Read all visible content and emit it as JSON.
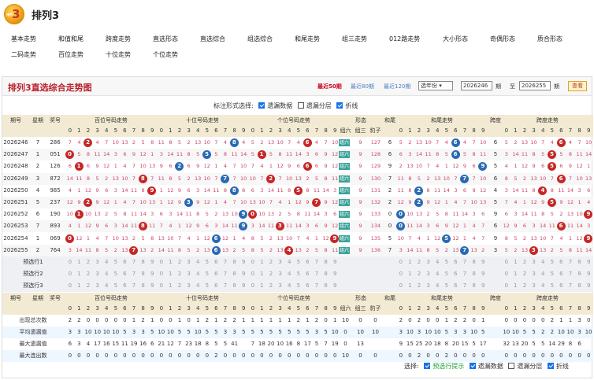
{
  "app": {
    "title": "排列3",
    "logo_text": "3"
  },
  "nav": [
    "基本走势",
    "和值和尾",
    "跨度走势",
    "直选形态",
    "直选综合",
    "组选综合",
    "和尾走势",
    "组三走势",
    "012路走势",
    "大小形态",
    "奇偶形态",
    "质合形态",
    "二码走势",
    "百位走势",
    "十位走势",
    "个位走势"
  ],
  "panel": {
    "title": "排列3直选综合走势图",
    "recent50": "最近50期",
    "recent80": "最近80期",
    "recent120": "最近120期",
    "year_select": "选年份",
    "from_issue": "2026246",
    "to_label": "至",
    "to_issue": "2026255",
    "issue_unit": "期",
    "query": "查看"
  },
  "options": {
    "label": "标注形式选择:",
    "miss": "遗漏数据",
    "layer": "遗漏分层",
    "line": "折线"
  },
  "headers": {
    "issue": "期号",
    "weekday": "星期",
    "prize": "奖号",
    "hundreds": "百位号码走势",
    "tens": "十位号码走势",
    "units": "个位号码走势",
    "form": "形态",
    "sum_tail": "和尾",
    "sum_trend": "和尾走势",
    "span": "跨度",
    "span_trend": "跨度走势",
    "form_cols": [
      "组六",
      "组三",
      "豹子"
    ]
  },
  "rows": [
    {
      "issue": "2026246",
      "week": "7",
      "prize": "286",
      "form": "组六",
      "v": "127"
    },
    {
      "issue": "2026247",
      "week": "1",
      "prize": "051",
      "form": "组六",
      "v": "128"
    },
    {
      "issue": "2026248",
      "week": "2",
      "prize": "126",
      "form": "组六",
      "v": "129"
    },
    {
      "issue": "2026249",
      "week": "3",
      "prize": "872",
      "form": "组六",
      "v": "130"
    },
    {
      "issue": "2026250",
      "week": "4",
      "prize": "985",
      "form": "组六",
      "v": "131"
    },
    {
      "issue": "2026251",
      "week": "5",
      "prize": "237",
      "form": "组六",
      "v": "132"
    },
    {
      "issue": "2026252",
      "week": "6",
      "prize": "190",
      "form": "组六",
      "v": "133"
    },
    {
      "issue": "2026253",
      "week": "7",
      "prize": "893",
      "form": "组六",
      "v": "134"
    },
    {
      "issue": "2026254",
      "week": "1",
      "prize": "069",
      "form": "组六",
      "v": "135"
    },
    {
      "issue": "2026255",
      "week": "2",
      "prize": "764",
      "form": "组六",
      "v": "136"
    }
  ],
  "predict": [
    "预选行1",
    "预选行2",
    "预选行3"
  ],
  "stats": [
    {
      "label": "出现总次数",
      "h": "2 2 0 0 0 0 0 1 2 1",
      "t": "0 0 1 0 1 2 1 2 2 1",
      "u": "1 1 1 1 1 2 1 2 0 1",
      "f": "10 0 0",
      "s": "2 0 2 0 0 1 2 2 0 1",
      "p": "0 0 0 0 0 2 1 1 3 0 0"
    },
    {
      "label": "平均遗漏值",
      "h": "3 3 10 10 10 10 5 3 3 5",
      "t": "10 10 5 5 10 5 5 3 3 5",
      "u": "5 5 5 5 5 5 5 3 5 10 5",
      "f": "0 10 10",
      "s": "3 10 3 10 10 5 3 3 10 5",
      "p": "10 10 5 5 2 2 10 10 3 10"
    },
    {
      "label": "最大遗漏值",
      "h": "6 3 4 17 16 15 11 19 16 6",
      "t": "21 12 7 23 18 8 5 5 41",
      "u": "7 18 20 10 16 8 17 5 7 19 80 13",
      "f": "0 13",
      "s": "9 15 25 20 18 8 20 15 5 17",
      "p": "32 13 20 5 5 14 29 8 6"
    },
    {
      "label": "最大连出数",
      "h": "0 0 0 0 0 0 0 0 0 0",
      "t": "0 0 0 0 0 0 2 0 0 0",
      "u": "0 0 0 0 0 0 0 0 0 0",
      "f": "10 0 0",
      "s": "0 0 2 0 0 2 0 0 0 0",
      "p": "0 0 0 0 0 0 0 0 0 0"
    }
  ],
  "footer": {
    "label": "选择:",
    "opt1": "预选行提示",
    "opt2": "遗漏数据",
    "opt3": "遗漏分层",
    "opt4": "折线"
  },
  "colors": {
    "accent": "#b8202a",
    "ball_red": "#c62828",
    "ball_blue": "#2a6ab5",
    "header_bg": "#f2ead2"
  }
}
